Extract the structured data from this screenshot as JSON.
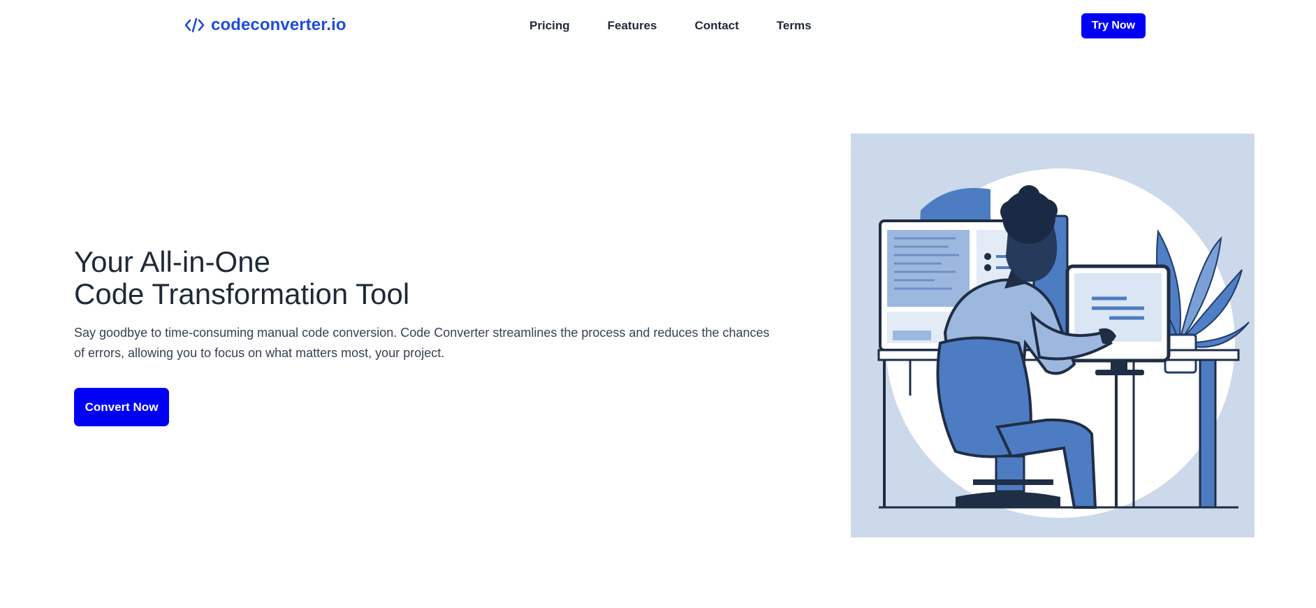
{
  "header": {
    "logo_symbol": "</>",
    "logo_text": "codeconverter.io",
    "nav": [
      {
        "label": "Pricing"
      },
      {
        "label": "Features"
      },
      {
        "label": "Contact"
      },
      {
        "label": "Terms"
      }
    ],
    "cta_label": "Try Now"
  },
  "hero": {
    "title_line1": "Your All-in-One",
    "title_line2": "Code Transformation Tool",
    "description": "Say goodbye to time-consuming manual code conversion. Code Converter streamlines the process and reduces the chances of errors, allowing you to focus on what matters most, your project.",
    "cta_label": "Convert Now"
  },
  "colors": {
    "brand": "#1d4ed8",
    "button": "#0000f5",
    "illustration_bg": "#ccd9ea"
  },
  "icons": {
    "logo": "code-brackets-icon"
  }
}
